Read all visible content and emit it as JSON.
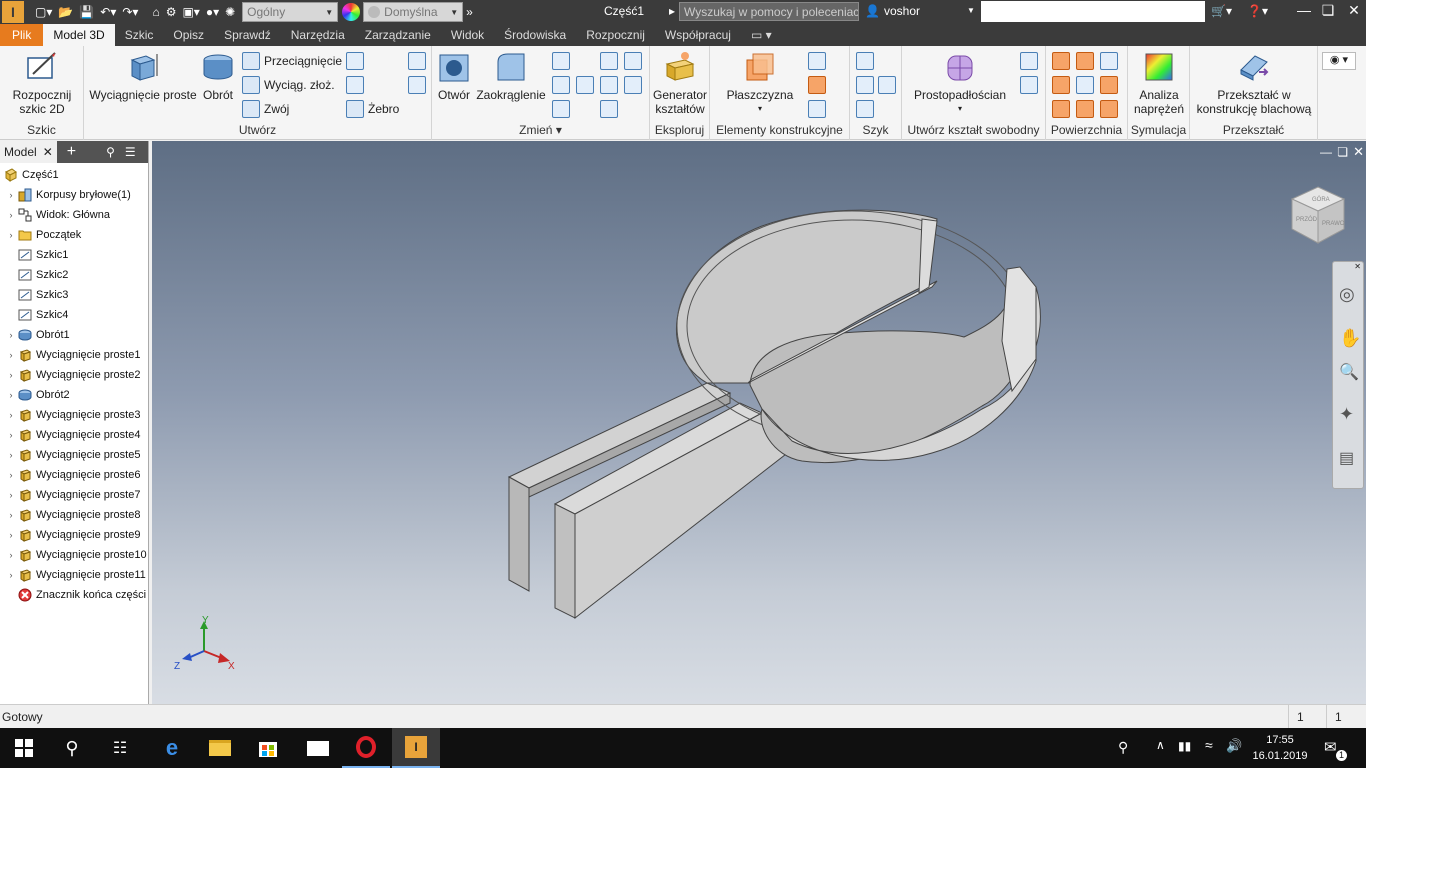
{
  "titlebar": {
    "appearance_select": "Ogólny",
    "material_select": "Domyślna",
    "document_title": "Część1",
    "search_placeholder": "Wyszukaj w pomocy i poleceniac",
    "user": "voshor"
  },
  "ribbon_tabs": [
    "Plik",
    "Model 3D",
    "Szkic",
    "Opisz",
    "Sprawdź",
    "Narzędzia",
    "Zarządzanie",
    "Widok",
    "Środowiska",
    "Rozpocznij",
    "Współpracuj"
  ],
  "ribbon": {
    "szkic": {
      "label": "Szkic",
      "start_sketch": "Rozpocznij szkic 2D"
    },
    "utworz": {
      "label": "Utwórz",
      "extrude": "Wyciągnięcie proste",
      "revolve": "Obrót",
      "sweep": "Przeciągnięcie",
      "loft": "Wyciąg. złoż.",
      "coil": "Zwój",
      "rib": "Żebro"
    },
    "zmien": {
      "label": "Zmień",
      "hole": "Otwór",
      "fillet": "Zaokrąglenie"
    },
    "eksploruj": {
      "label": "Eksploruj",
      "shape_generator": "Generator kształtów"
    },
    "elementy": {
      "label": "Elementy konstrukcyjne",
      "plane": "Płaszczyzna"
    },
    "szyk": {
      "label": "Szyk"
    },
    "swobodny": {
      "label": "Utwórz kształt swobodny",
      "box": "Prostopadłościan"
    },
    "powierzchnia": {
      "label": "Powierzchnia"
    },
    "symulacja": {
      "label": "Symulacja",
      "stress": "Analiza naprężeń"
    },
    "przeksztalc": {
      "label": "Przekształć",
      "convert": "Przekształć w konstrukcję blachową"
    }
  },
  "browser": {
    "tab": "Model",
    "items": [
      {
        "label": "Część1",
        "icon": "part-icon",
        "toggle": ""
      },
      {
        "label": "Korpusy bryłowe(1)",
        "icon": "solid-bodies-icon",
        "toggle": "›"
      },
      {
        "label": "Widok: Główna",
        "icon": "view-icon",
        "toggle": "›"
      },
      {
        "label": "Początek",
        "icon": "folder-icon",
        "toggle": "›"
      },
      {
        "label": "Szkic1",
        "icon": "sketch-icon",
        "toggle": ""
      },
      {
        "label": "Szkic2",
        "icon": "sketch-icon",
        "toggle": ""
      },
      {
        "label": "Szkic3",
        "icon": "sketch-icon",
        "toggle": ""
      },
      {
        "label": "Szkic4",
        "icon": "sketch-icon",
        "toggle": ""
      },
      {
        "label": "Obrót1",
        "icon": "revolve-icon",
        "toggle": "›"
      },
      {
        "label": "Wyciągnięcie proste1",
        "icon": "extrude-icon",
        "toggle": "›"
      },
      {
        "label": "Wyciągnięcie proste2",
        "icon": "extrude-icon",
        "toggle": "›"
      },
      {
        "label": "Obrót2",
        "icon": "revolve-icon",
        "toggle": "›"
      },
      {
        "label": "Wyciągnięcie proste3",
        "icon": "extrude-icon",
        "toggle": "›"
      },
      {
        "label": "Wyciągnięcie proste4",
        "icon": "extrude-icon",
        "toggle": "›"
      },
      {
        "label": "Wyciągnięcie proste5",
        "icon": "extrude-icon",
        "toggle": "›"
      },
      {
        "label": "Wyciągnięcie proste6",
        "icon": "extrude-icon",
        "toggle": "›"
      },
      {
        "label": "Wyciągnięcie proste7",
        "icon": "extrude-icon",
        "toggle": "›"
      },
      {
        "label": "Wyciągnięcie proste8",
        "icon": "extrude-icon",
        "toggle": "›"
      },
      {
        "label": "Wyciągnięcie proste9",
        "icon": "extrude-icon",
        "toggle": "›"
      },
      {
        "label": "Wyciągnięcie proste10",
        "icon": "extrude-icon",
        "toggle": "›"
      },
      {
        "label": "Wyciągnięcie proste11",
        "icon": "extrude-icon",
        "toggle": "›"
      },
      {
        "label": "Znacznik końca części",
        "icon": "end-of-part-icon",
        "toggle": ""
      }
    ]
  },
  "viewcube": {
    "top": "GÓRA",
    "front": "PRZÓD",
    "right": "PRAWO"
  },
  "axes": {
    "x": "X",
    "y": "Y",
    "z": "Z"
  },
  "statusbar": {
    "status": "Gotowy",
    "count1": "1",
    "count2": "1"
  },
  "taskbar": {
    "time": "17:55",
    "date": "16.01.2019",
    "notifications": "1"
  },
  "colors": {
    "accent": "#e77b1e",
    "titlebar": "#3b3b3b",
    "taskbar": "#101010",
    "model": "#c9c9c9"
  }
}
